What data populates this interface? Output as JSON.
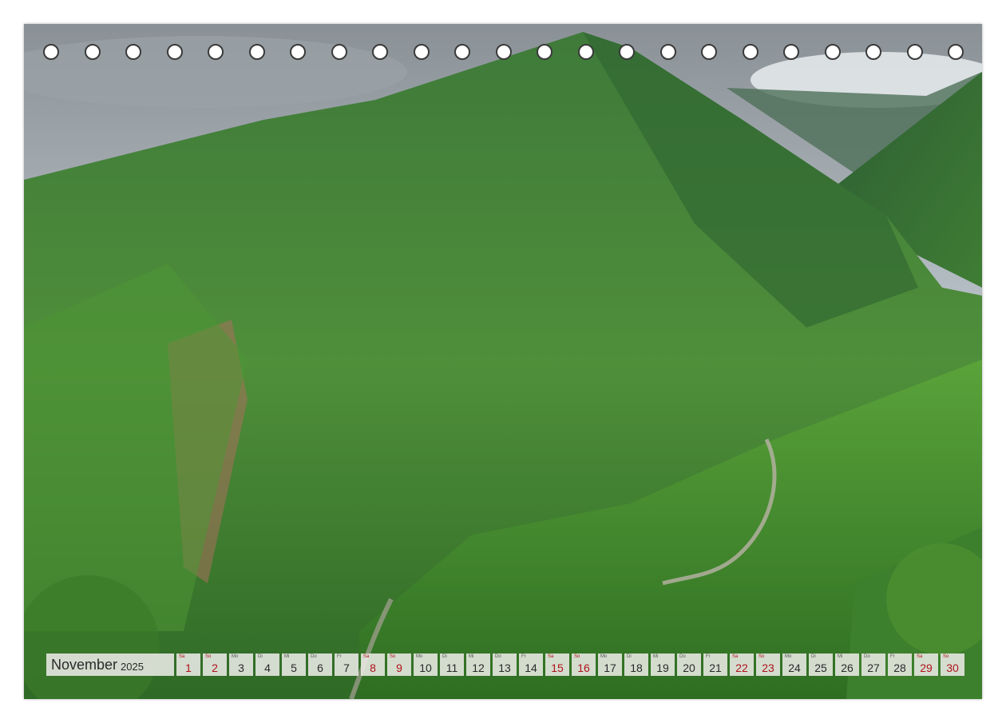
{
  "calendar": {
    "month": "November",
    "year": "2025",
    "days": [
      {
        "wd": "Sa",
        "n": "1",
        "weekend": true
      },
      {
        "wd": "So",
        "n": "2",
        "weekend": true
      },
      {
        "wd": "Mo",
        "n": "3",
        "weekend": false
      },
      {
        "wd": "Di",
        "n": "4",
        "weekend": false
      },
      {
        "wd": "Mi",
        "n": "5",
        "weekend": false
      },
      {
        "wd": "Do",
        "n": "6",
        "weekend": false
      },
      {
        "wd": "Fr",
        "n": "7",
        "weekend": false
      },
      {
        "wd": "Sa",
        "n": "8",
        "weekend": true
      },
      {
        "wd": "So",
        "n": "9",
        "weekend": true
      },
      {
        "wd": "Mo",
        "n": "10",
        "weekend": false
      },
      {
        "wd": "Di",
        "n": "11",
        "weekend": false
      },
      {
        "wd": "Mi",
        "n": "12",
        "weekend": false
      },
      {
        "wd": "Do",
        "n": "13",
        "weekend": false
      },
      {
        "wd": "Fr",
        "n": "14",
        "weekend": false
      },
      {
        "wd": "Sa",
        "n": "15",
        "weekend": true
      },
      {
        "wd": "So",
        "n": "16",
        "weekend": true
      },
      {
        "wd": "Mo",
        "n": "17",
        "weekend": false
      },
      {
        "wd": "Di",
        "n": "18",
        "weekend": false
      },
      {
        "wd": "Mi",
        "n": "19",
        "weekend": false
      },
      {
        "wd": "Do",
        "n": "20",
        "weekend": false
      },
      {
        "wd": "Fr",
        "n": "21",
        "weekend": false
      },
      {
        "wd": "Sa",
        "n": "22",
        "weekend": true
      },
      {
        "wd": "So",
        "n": "23",
        "weekend": true
      },
      {
        "wd": "Mo",
        "n": "24",
        "weekend": false
      },
      {
        "wd": "Di",
        "n": "25",
        "weekend": false
      },
      {
        "wd": "Mi",
        "n": "26",
        "weekend": false
      },
      {
        "wd": "Do",
        "n": "27",
        "weekend": false
      },
      {
        "wd": "Fr",
        "n": "28",
        "weekend": false
      },
      {
        "wd": "Sa",
        "n": "29",
        "weekend": true
      },
      {
        "wd": "So",
        "n": "30",
        "weekend": true
      }
    ]
  },
  "colors": {
    "weekend": "#b0121b",
    "text": "#2a2a2a"
  }
}
